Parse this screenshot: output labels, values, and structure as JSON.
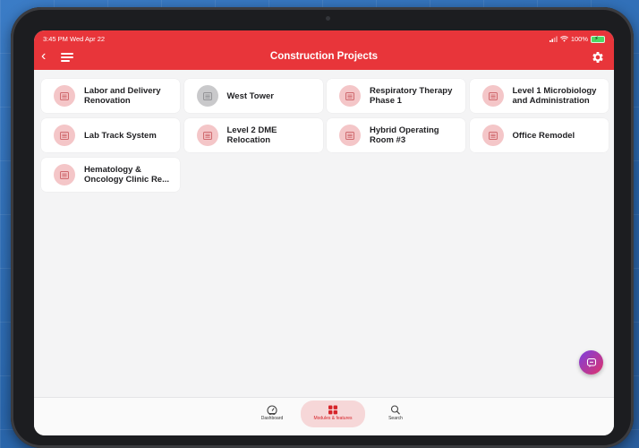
{
  "status_bar": {
    "time": "3:45 PM  Wed Apr 22",
    "battery": "100%"
  },
  "header": {
    "title": "Construction Projects",
    "back_icon": "chevron-left-icon",
    "menu_icon": "menu-icon",
    "settings_icon": "gear-icon"
  },
  "projects": [
    {
      "label": "Labor and Delivery\nRenovation",
      "icon": "building-icon",
      "gray": false
    },
    {
      "label": "West Tower",
      "icon": "building-icon",
      "gray": true
    },
    {
      "label": "Respiratory Therapy\nPhase 1",
      "icon": "building-icon",
      "gray": false
    },
    {
      "label": "Level 1 Microbiology\nand Administration",
      "icon": "building-icon",
      "gray": false
    },
    {
      "label": "Lab Track System",
      "icon": "building-icon",
      "gray": false
    },
    {
      "label": "Level 2 DME\nRelocation",
      "icon": "building-icon",
      "gray": false
    },
    {
      "label": "Hybrid Operating\nRoom #3",
      "icon": "building-icon",
      "gray": false
    },
    {
      "label": "Office Remodel",
      "icon": "building-icon",
      "gray": false
    },
    {
      "label": "Hematology &\nOncology Clinic Re...",
      "icon": "building-icon",
      "gray": false
    }
  ],
  "tabbar": {
    "dashboard": "Dashboard",
    "modules": "Modules & features",
    "search": "Search"
  },
  "colors": {
    "accent": "#e8353a",
    "icon_bg": "#f4c6c8",
    "icon_bg_inactive": "#c9c9cb"
  }
}
